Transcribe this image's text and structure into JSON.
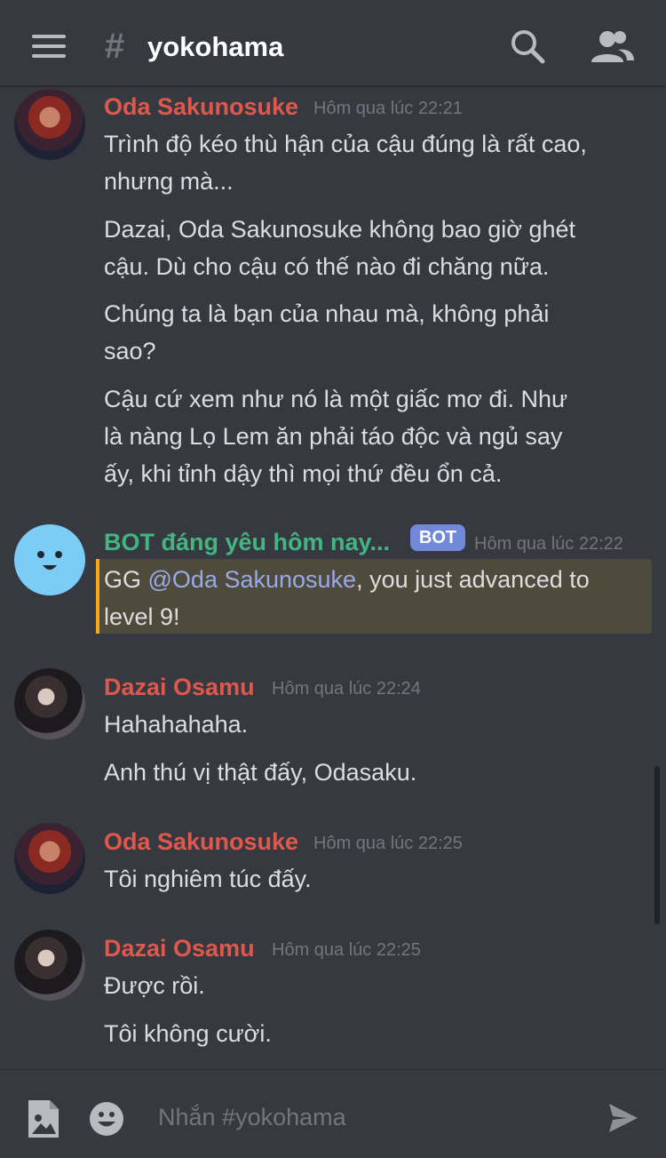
{
  "header": {
    "channel_hash": "#",
    "channel_name": "yokohama"
  },
  "messages": [
    {
      "author": "Oda Sakunosuke",
      "timestamp": "Hôm qua lúc 22:21",
      "lines": [
        "Trình độ kéo thù hận của cậu đúng là rất cao,",
        "nhưng mà...",
        "Dazai, Oda Sakunosuke không bao giờ ghét",
        "cậu. Dù cho cậu có thế nào đi chăng nữa.",
        "Chúng ta là bạn của nhau mà, không phải",
        "sao?",
        "Cậu cứ xem như nó là một giấc mơ đi. Như",
        "là nàng Lọ Lem ăn phải táo độc và ngủ say",
        "ấy, khi tỉnh dậy thì mọi thứ đều ổn cả."
      ]
    },
    {
      "author": "BOT đáng yêu hôm nay...",
      "bot_tag": "BOT",
      "timestamp": "Hôm qua lúc 22:22",
      "text_before": "GG ",
      "mention": "@Oda Sakunosuke",
      "text_after": ", you just advanced to",
      "line2": "level 9!"
    },
    {
      "author": "Dazai Osamu",
      "timestamp": "Hôm qua lúc 22:24",
      "lines": [
        "Hahahahaha.",
        "Anh thú vị thật đấy, Odasaku."
      ]
    },
    {
      "author": "Oda Sakunosuke",
      "timestamp": "Hôm qua lúc 22:25",
      "lines": [
        "Tôi nghiêm túc đấy."
      ]
    },
    {
      "author": "Dazai Osamu",
      "timestamp": "Hôm qua lúc 22:25",
      "lines": [
        "Được rồi.",
        "Tôi không cười."
      ]
    }
  ],
  "composer": {
    "placeholder": "Nhắn #yokohama"
  },
  "colors": {
    "background": "#36393f",
    "author_red": "#e0584c",
    "bot_green": "#43b581",
    "bot_tag": "#7289da",
    "mention_bar": "#faa61a"
  },
  "icons": [
    "menu-icon",
    "search-icon",
    "members-icon",
    "image-icon",
    "emoji-icon",
    "send-icon"
  ]
}
